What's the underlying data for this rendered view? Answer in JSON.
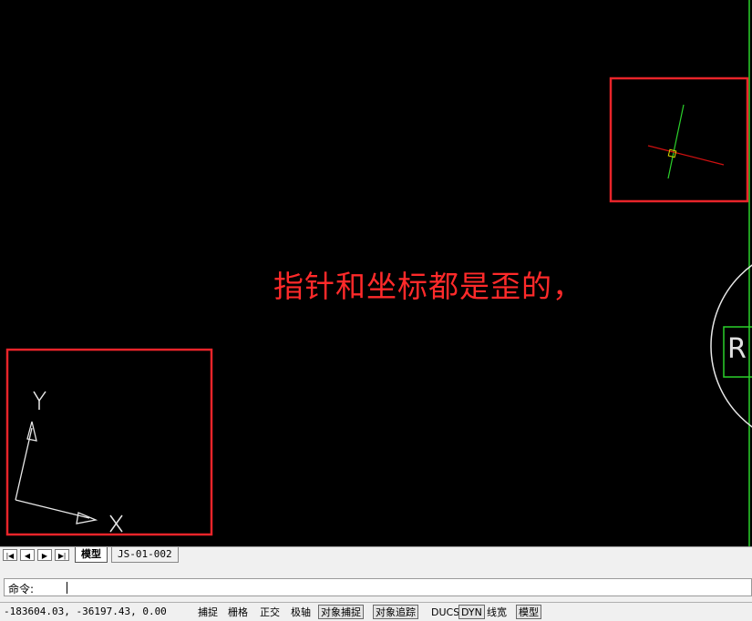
{
  "annotation": "指针和坐标都是歪的，",
  "canvas_text": {
    "r_letter": "R",
    "ucs_x": "X",
    "ucs_y": "Y"
  },
  "colors": {
    "highlight_box": "#e8242a",
    "annotation": "#ff2a2a",
    "crosshair_y": "#2bd12b",
    "crosshair_x": "#d01010",
    "background": "#000000"
  },
  "tabs": {
    "nav": [
      "|◀",
      "◀",
      "▶",
      "▶|"
    ],
    "items": [
      {
        "label": "模型",
        "active": true
      },
      {
        "label": "JS-01-002",
        "active": false
      }
    ]
  },
  "command": {
    "prompt": "命令:"
  },
  "status": {
    "coords": "-183604.03, -36197.43, 0.00",
    "buttons": [
      {
        "label": "捕捉",
        "on": false
      },
      {
        "label": "栅格",
        "on": false
      },
      {
        "label": "正交",
        "on": false
      },
      {
        "label": "极轴",
        "on": false
      },
      {
        "label": "对象捕捉",
        "on": true
      },
      {
        "label": "对象追踪",
        "on": true
      },
      {
        "label": "DUCS",
        "on": false
      },
      {
        "label": "DYN",
        "on": true
      },
      {
        "label": "线宽",
        "on": false
      },
      {
        "label": "模型",
        "on": true
      }
    ]
  }
}
